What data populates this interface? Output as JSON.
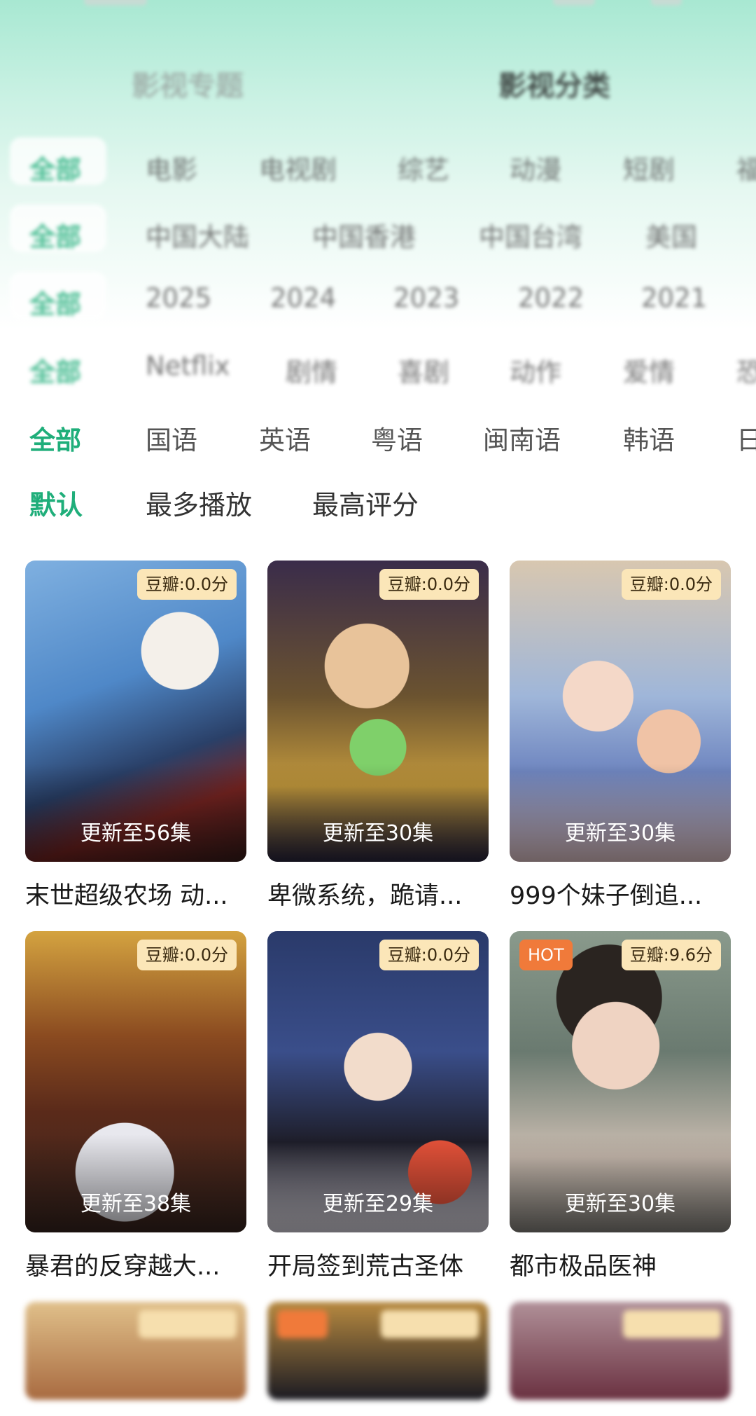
{
  "topic_tabs": [
    "影视专题",
    "影视分类"
  ],
  "filters": {
    "type": {
      "items": [
        "全部",
        "电影",
        "电视剧",
        "综艺",
        "动漫",
        "短剧",
        "福"
      ],
      "active": 0
    },
    "region": {
      "items": [
        "全部",
        "中国大陆",
        "中国香港",
        "中国台湾",
        "美国"
      ],
      "active": 0
    },
    "year": {
      "items": [
        "全部",
        "2025",
        "2024",
        "2023",
        "2022",
        "2021"
      ],
      "active": 0
    },
    "genre": {
      "items": [
        "全部",
        "Netflix",
        "剧情",
        "喜剧",
        "动作",
        "爱情",
        "恐"
      ],
      "active": 0
    },
    "language": {
      "items": [
        "全部",
        "国语",
        "英语",
        "粤语",
        "闽南语",
        "韩语",
        "日"
      ],
      "active": 0
    }
  },
  "sort": {
    "items": [
      "默认",
      "最多播放",
      "最高评分"
    ],
    "active": 0
  },
  "cards": [
    {
      "title": "末世超级农场 动...",
      "rating": "豆瓣:0.0分",
      "episode": "更新至56集",
      "hot": ""
    },
    {
      "title": "卑微系统，跪请...",
      "rating": "豆瓣:0.0分",
      "episode": "更新至30集",
      "hot": ""
    },
    {
      "title": "999个妹子倒追...",
      "rating": "豆瓣:0.0分",
      "episode": "更新至30集",
      "hot": ""
    },
    {
      "title": "暴君的反穿越大...",
      "rating": "豆瓣:0.0分",
      "episode": "更新至38集",
      "hot": ""
    },
    {
      "title": "开局签到荒古圣体",
      "rating": "豆瓣:0.0分",
      "episode": "更新至29集",
      "hot": ""
    },
    {
      "title": "都市极品医神",
      "rating": "豆瓣:9.6分",
      "episode": "更新至30集",
      "hot": "HOT"
    }
  ]
}
